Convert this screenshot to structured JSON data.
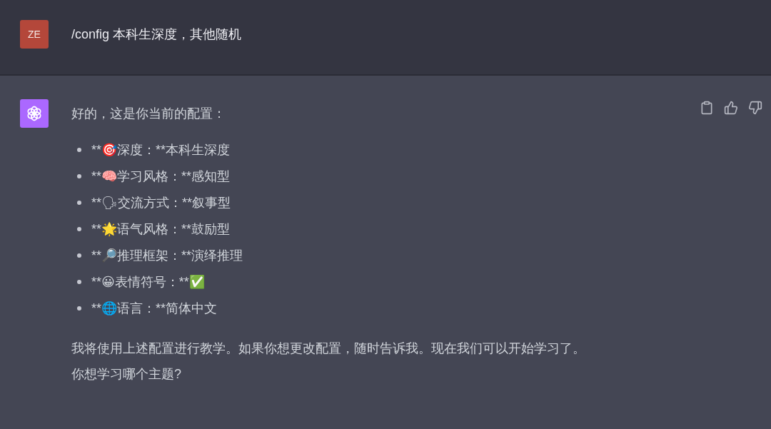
{
  "user_message": {
    "avatar": "ZE",
    "text": "/config 本科生深度，其他随机"
  },
  "assistant_message": {
    "intro": "好的，这是你当前的配置：",
    "items": [
      "**🎯深度：**本科生深度",
      "**🧠学习风格：**感知型",
      "**🗣交流方式：**叙事型",
      "**🌟语气风格：**鼓励型",
      "**🔎推理框架：**演绎推理",
      "**😀表情符号：**✅",
      "**🌐语言：**简体中文"
    ],
    "closing": [
      "我将使用上述配置进行教学。如果你想更改配置，随时告诉我。现在我们可以开始学习了。",
      "你想学习哪个主题?"
    ]
  }
}
